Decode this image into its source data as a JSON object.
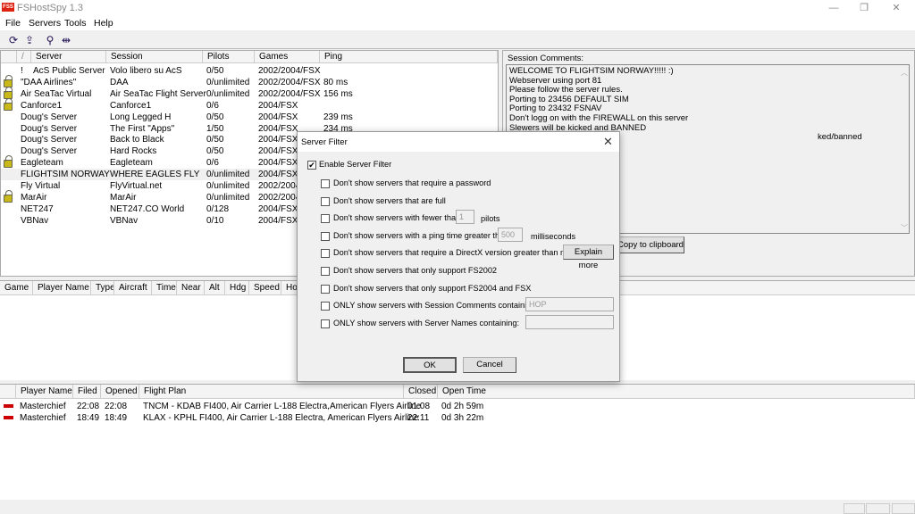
{
  "app": {
    "title": "FSHostSpy 1.3",
    "logo": "FSS"
  },
  "window_controls": {
    "minimize": "—",
    "restore": "❐",
    "close": "✕"
  },
  "menu": [
    "File",
    "Servers",
    "Tools",
    "Help"
  ],
  "toolbar": [
    "refresh-icon",
    "refresh-all-icon",
    "filter-icon",
    "connect-icon"
  ],
  "server_list": {
    "columns": [
      "/",
      "Server",
      "Session",
      "Pilots",
      "Games",
      "Ping"
    ],
    "rows": [
      {
        "flag": "!",
        "locked": false,
        "server": "AcS Public Server",
        "session": "Volo libero su AcS",
        "pilots": "0/50",
        "games": "2002/2004/FSX",
        "ping": ""
      },
      {
        "flag": "",
        "locked": true,
        "server": "\"DAA Airlines\"",
        "session": "DAA",
        "pilots": "0/unlimited",
        "games": "2002/2004/FSX",
        "ping": "80 ms"
      },
      {
        "flag": "",
        "locked": true,
        "server": "Air SeaTac Virtual",
        "session": "Air SeaTac Flight Server",
        "pilots": "0/unlimited",
        "games": "2002/2004/FSX",
        "ping": "156 ms"
      },
      {
        "flag": "",
        "locked": true,
        "server": "Canforce1",
        "session": "Canforce1",
        "pilots": "0/6",
        "games": "2004/FSX",
        "ping": ""
      },
      {
        "flag": "",
        "locked": false,
        "server": "Doug's Server",
        "session": "Long Legged H",
        "pilots": "0/50",
        "games": "2004/FSX",
        "ping": "239 ms"
      },
      {
        "flag": "",
        "locked": false,
        "server": "Doug's Server",
        "session": "The First \"Apps\"",
        "pilots": "1/50",
        "games": "2004/FSX",
        "ping": "234 ms"
      },
      {
        "flag": "",
        "locked": false,
        "server": "Doug's Server",
        "session": "Back to Black",
        "pilots": "0/50",
        "games": "2004/FSX",
        "ping": ""
      },
      {
        "flag": "",
        "locked": false,
        "server": "Doug's Server",
        "session": "Hard Rocks",
        "pilots": "0/50",
        "games": "2004/FSX",
        "ping": ""
      },
      {
        "flag": "",
        "locked": true,
        "server": "Eagleteam",
        "session": "Eagleteam",
        "pilots": "0/6",
        "games": "2004/FSX",
        "ping": ""
      },
      {
        "flag": "",
        "locked": false,
        "selected": true,
        "server": "FLIGHTSIM NORWAY",
        "session": "WHERE EAGLES FLY",
        "pilots": "0/unlimited",
        "games": "2004/FSX",
        "ping": ""
      },
      {
        "flag": "",
        "locked": false,
        "server": "Fly Virtual",
        "session": "FlyVirtual.net",
        "pilots": "0/unlimited",
        "games": "2002/2004",
        "ping": ""
      },
      {
        "flag": "",
        "locked": true,
        "server": "MarAir",
        "session": "MarAir",
        "pilots": "0/unlimited",
        "games": "2002/2004",
        "ping": ""
      },
      {
        "flag": "",
        "locked": false,
        "server": "NET247",
        "session": "NET247.CO World",
        "pilots": "0/128",
        "games": "2004/FSX",
        "ping": ""
      },
      {
        "flag": "",
        "locked": false,
        "server": "VBNav",
        "session": "VBNav",
        "pilots": "0/10",
        "games": "2004/FSX",
        "ping": ""
      }
    ]
  },
  "session_comments": {
    "label": "Session Comments:",
    "lines": [
      "WELCOME TO FLIGHTSIM NORWAY!!!!! :)",
      "Webserver using port 81",
      "Please follow the server rules.",
      "Porting to 23456 DEFAULT SIM",
      "Porting to 23432 FSNAV",
      "Don't logg on with the FIREWALL on this server",
      "Slewers will be kicked and BANNED",
      "ked/banned"
    ],
    "copy_button": "Copy to clipboard"
  },
  "player_list": {
    "columns": [
      "Game",
      "Player Name",
      "Type",
      "Aircraft",
      "Time",
      "Near",
      "Alt",
      "Hdg",
      "Speed",
      "Ho"
    ]
  },
  "flight_plans": {
    "columns": [
      "",
      "Player Name",
      "Filed",
      "Opened",
      "Flight Plan",
      "Closed",
      "Open Time"
    ],
    "rows": [
      {
        "player": "Masterchief",
        "filed": "22:08",
        "opened": "22:08",
        "plan": "TNCM - KDAB FI400, Air Carrier L-188 Electra,American Flyers Airline",
        "closed": "01:08",
        "open_time": "0d 2h 59m"
      },
      {
        "player": "Masterchief",
        "filed": "18:49",
        "opened": "18:49",
        "plan": "KLAX - KPHL FI400, Air Carrier L-188 Electra, American Flyers Airline",
        "closed": "22:11",
        "open_time": "0d 3h 22m"
      }
    ]
  },
  "dialog": {
    "title": "Server Filter",
    "enable": {
      "label": "Enable Server Filter",
      "checked": true
    },
    "options": [
      {
        "label": "Don't show servers that require a password",
        "checked": false
      },
      {
        "label": "Don't show servers that are full",
        "checked": false
      },
      {
        "label": "Don't show servers with fewer than",
        "checked": false,
        "input": "1",
        "suffix": "pilots"
      },
      {
        "label": "Don't show servers with a ping time greater than",
        "checked": false,
        "input": "500",
        "suffix": "milliseconds"
      },
      {
        "label": "Don't show servers that require a DirectX version greater than mine",
        "checked": false,
        "button": "Explain more"
      },
      {
        "label": "Don't show servers that only support FS2002",
        "checked": false
      },
      {
        "label": "Don't show servers that only support FS2004 and FSX",
        "checked": false
      },
      {
        "label": "ONLY show servers with Session Comments containing:",
        "checked": false,
        "input": "HOP"
      },
      {
        "label": "ONLY show servers with Server Names containing:",
        "checked": false,
        "input": ""
      }
    ],
    "ok": "OK",
    "cancel": "Cancel"
  },
  "colors": {
    "lock": "#c8b818",
    "flag": "#cc0000",
    "selected_row": "#f0f0f0"
  }
}
